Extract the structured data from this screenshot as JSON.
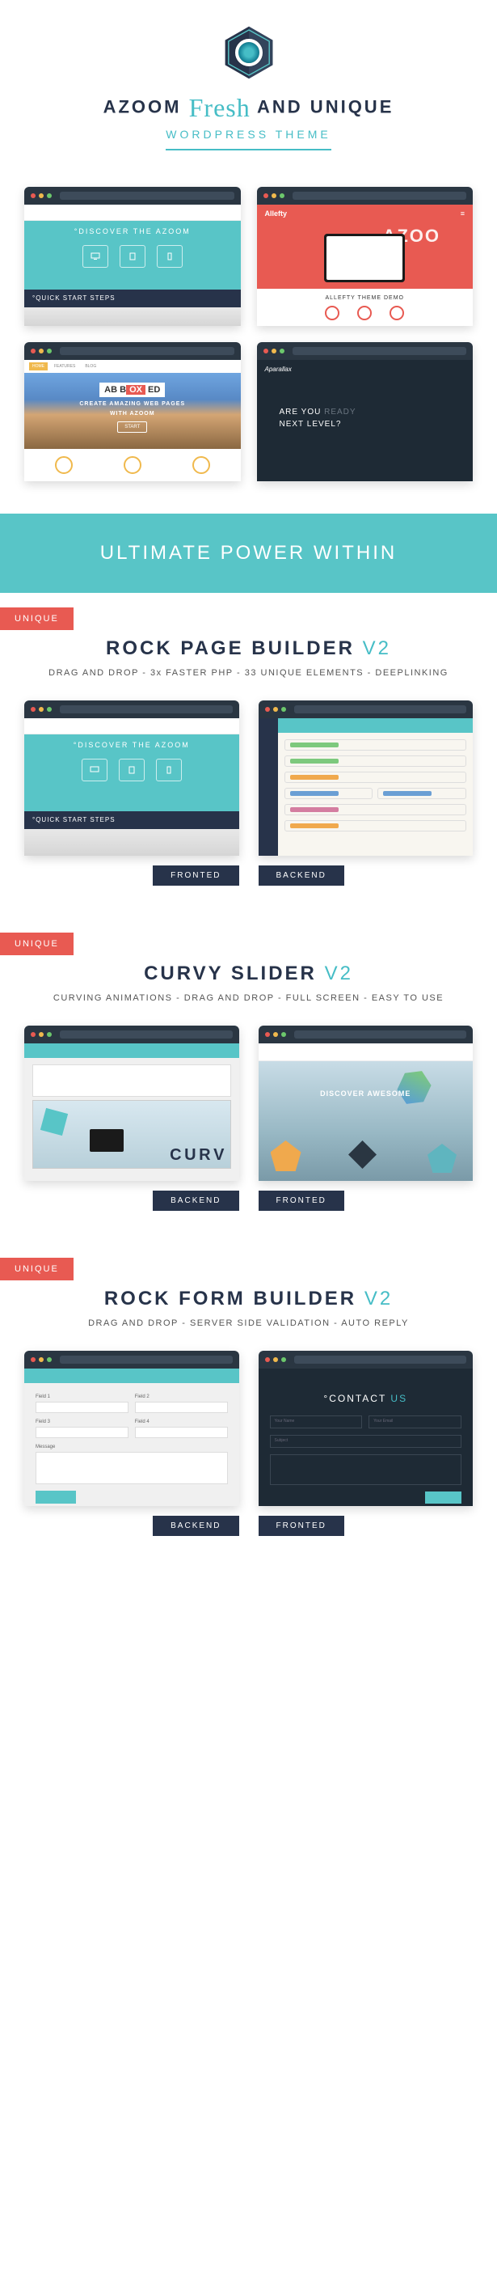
{
  "hero": {
    "title_pre": "AZOOM",
    "title_mid": "Fresh",
    "title_post": "AND UNIQUE",
    "subtitle": "WORDPRESS THEME"
  },
  "demos": {
    "d1": {
      "discover": "°DISCOVER THE AZOOM",
      "quickstart": "°QUICK START STEPS"
    },
    "d2": {
      "logo": "Allefty",
      "brand": "AZOO",
      "footer_title": "ALLEFTY THEME DEMO"
    },
    "d3": {
      "box_pre": "AB B",
      "box_mid": "OX",
      "box_post": " ED",
      "line1": "CREATE AMAZING WEB PAGES",
      "line2": "WITH AZOOM",
      "btn": "START"
    },
    "d4": {
      "logo": "Aparallax",
      "line1_a": "ARE YOU ",
      "line1_b": "READY",
      "line2": "NEXT LEVEL?"
    }
  },
  "banner": "ULTIMATE POWER WITHIN",
  "tags": {
    "unique": "UNIQUE"
  },
  "sections": {
    "rockpage": {
      "title": "ROCK PAGE BUILDER",
      "version": "V2",
      "sub": "DRAG AND DROP - 3x FASTER PHP - 33 UNIQUE ELEMENTS - DEEPLINKING",
      "frontend_discover": "°DISCOVER THE AZOOM",
      "frontend_quick": "°QUICK START STEPS",
      "labels": {
        "front": "FRONTED",
        "back": "BACKEND"
      }
    },
    "curvy": {
      "title": "CURVY SLIDER",
      "version": "V2",
      "sub": "CURVING ANIMATIONS - DRAG AND DROP - FULL SCREEN - EASY TO USE",
      "backend_letters": "C U R V",
      "frontend_text": "DISCOVER AWESOME",
      "labels": {
        "front": "FRONTED",
        "back": "BACKEND"
      }
    },
    "rockform": {
      "title": "ROCK FORM BUILDER",
      "version": "V2",
      "sub": "DRAG AND DROP - SERVER SIDE VALIDATION - AUTO REPLY",
      "front": {
        "title_a": "°CONTACT",
        "title_b": " US",
        "ph1": "Your Name",
        "ph2": "Your Email",
        "ph3": "Subject"
      },
      "labels": {
        "front": "FRONTED",
        "back": "BACKEND"
      }
    }
  }
}
